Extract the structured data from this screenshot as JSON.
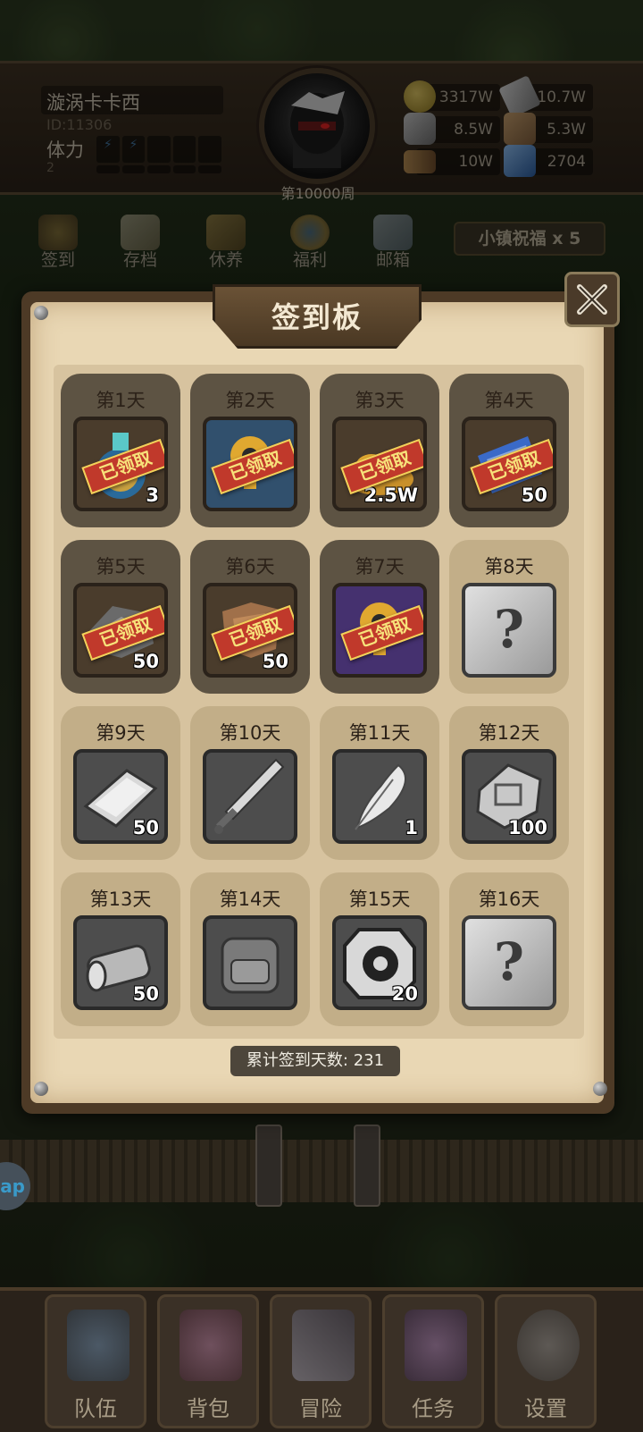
{
  "player": {
    "name": "漩涡卡卡西",
    "id": "ID:11306",
    "stamina_label": "体力",
    "stamina_value": "2",
    "week": "第10000周"
  },
  "resources": [
    {
      "icon": "gold-coin-icon",
      "value": "3317W"
    },
    {
      "icon": "iron-ingot-icon",
      "value": "10.7W"
    },
    {
      "icon": "stone-ore-icon",
      "value": "8.5W"
    },
    {
      "icon": "leather-hide-icon",
      "value": "5.3W"
    },
    {
      "icon": "wood-log-icon",
      "value": "10W"
    },
    {
      "icon": "blue-crystal-icon",
      "value": "2704"
    }
  ],
  "nav": [
    {
      "icon": "sign-in-icon",
      "label": "签到"
    },
    {
      "icon": "save-scroll-icon",
      "label": "存档"
    },
    {
      "icon": "rest-bed-icon",
      "label": "休养"
    },
    {
      "icon": "welfare-shield-icon",
      "label": "福利"
    },
    {
      "icon": "mailbox-icon",
      "label": "邮箱"
    }
  ],
  "blessing": "小镇祝福 x 5",
  "board": {
    "title": "签到板",
    "claimed_stamp": "已领取",
    "total_label": "累计签到天数: 231",
    "days": [
      {
        "label": "第1天",
        "item": "mana-potion-icon",
        "qty": "3",
        "claimed": true
      },
      {
        "label": "第2天",
        "item": "mystery-key-blue-icon",
        "qty": "",
        "claimed": true
      },
      {
        "label": "第3天",
        "item": "gold-pile-icon",
        "qty": "2.5W",
        "claimed": true
      },
      {
        "label": "第4天",
        "item": "blue-crystal-icon",
        "qty": "50",
        "claimed": true
      },
      {
        "label": "第5天",
        "item": "stone-ore-icon",
        "qty": "50",
        "claimed": true
      },
      {
        "label": "第6天",
        "item": "leather-hide-icon",
        "qty": "50",
        "claimed": true
      },
      {
        "label": "第7天",
        "item": "mystery-key-purple-icon",
        "qty": "",
        "claimed": true
      },
      {
        "label": "第8天",
        "item": "mystery-box-icon",
        "qty": "",
        "claimed": false
      },
      {
        "label": "第9天",
        "item": "iron-ingot-icon",
        "qty": "50",
        "claimed": false
      },
      {
        "label": "第10天",
        "item": "great-sword-icon",
        "qty": "",
        "claimed": false
      },
      {
        "label": "第11天",
        "item": "feather-icon",
        "qty": "1",
        "claimed": false
      },
      {
        "label": "第12天",
        "item": "silver-ore-icon",
        "qty": "100",
        "claimed": false
      },
      {
        "label": "第13天",
        "item": "wood-log-icon",
        "qty": "50",
        "claimed": false
      },
      {
        "label": "第14天",
        "item": "backpack-icon",
        "qty": "",
        "claimed": false
      },
      {
        "label": "第15天",
        "item": "rune-stone-icon",
        "qty": "20",
        "claimed": false
      },
      {
        "label": "第16天",
        "item": "mystery-box-icon",
        "qty": "",
        "claimed": false
      }
    ]
  },
  "tabs": [
    {
      "icon": "helmet-icon",
      "label": "队伍"
    },
    {
      "icon": "backpack-icon",
      "label": "背包"
    },
    {
      "icon": "crossed-swords-icon",
      "label": "冒险"
    },
    {
      "icon": "quest-flower-icon",
      "label": "任务"
    },
    {
      "icon": "gear-icon",
      "label": "设置"
    }
  ],
  "side_bubble": "ap",
  "colors": {
    "claimed_card": "#5d5343",
    "pending_card": "#c2ae88",
    "stamp_red": "#c0392b",
    "stamp_text": "#f7e27a",
    "parchment": "#e9d7b4"
  }
}
